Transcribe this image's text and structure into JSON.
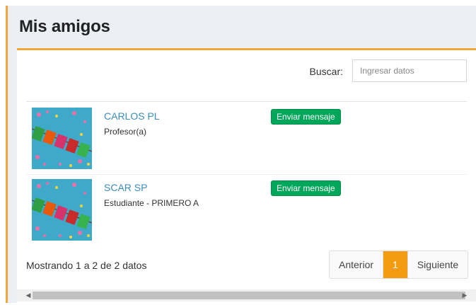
{
  "header": {
    "title": "Mis amigos"
  },
  "search": {
    "label": "Buscar:",
    "placeholder": "Ingresar datos"
  },
  "friends": [
    {
      "name": "CARLOS PL",
      "role": "Profesor(a)",
      "button": "Enviar mensaje"
    },
    {
      "name": "SCAR SP",
      "role": "Estudiante - PRIMERO A",
      "button": "Enviar mensaje"
    }
  ],
  "footer": {
    "info": "Mostrando 1 a 2 de 2 datos",
    "prev": "Anterior",
    "page": "1",
    "next": "Siguiente"
  },
  "colors": {
    "accent": "#f0a83a",
    "link": "#3c8dbc",
    "button": "#00a65a",
    "active_page": "#f39c12"
  }
}
